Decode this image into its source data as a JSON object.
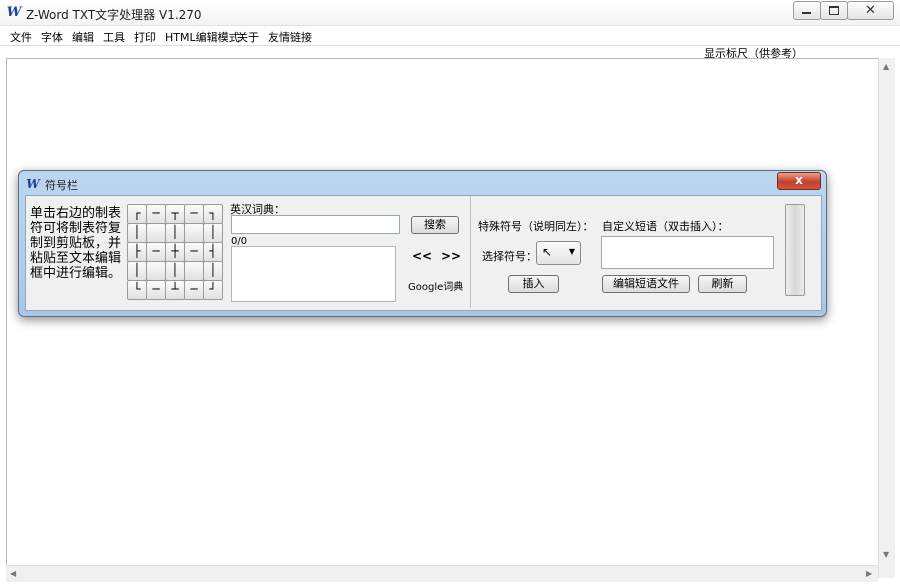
{
  "window": {
    "title": "Z-Word TXT文字处理器 V1.270",
    "app_icon": "W",
    "controls": {
      "minimize_icon": "minimize-icon",
      "maximize_icon": "maximize-icon",
      "close_icon": "close-icon"
    }
  },
  "menu": {
    "items": [
      {
        "label": "文件"
      },
      {
        "label": "字体"
      },
      {
        "label": "编辑"
      },
      {
        "label": "工具"
      },
      {
        "label": "打印"
      },
      {
        "label": "HTML编辑模式"
      },
      {
        "label": "关于"
      },
      {
        "label": "友情链接"
      }
    ]
  },
  "ruler_label": "显示标尺（供参考）",
  "palette": {
    "title": "符号栏",
    "icon": "W",
    "close_label": "x",
    "instructions": "单击右边的制表符可将制表符复制到剪贴板，并粘贴至文本编辑框中进行编辑。",
    "box_chars": [
      [
        "┌",
        "─",
        "┬",
        "─",
        "┐"
      ],
      [
        "│",
        "",
        "│",
        "",
        "│"
      ],
      [
        "├",
        "─",
        "┼",
        "─",
        "┤"
      ],
      [
        "│",
        "",
        "│",
        "",
        "│"
      ],
      [
        "└",
        "─",
        "┴",
        "─",
        "┘"
      ]
    ],
    "dictionary": {
      "label": "英汉词典：",
      "input_value": "",
      "search_label": "搜索",
      "count": "0/0",
      "prev_label": "<<",
      "next_label": ">>",
      "google_label": "Google词典"
    },
    "special": {
      "label": "特殊符号（说明同左）：",
      "select_label": "选择符号：",
      "selected_symbol": "↖",
      "insert_label": "插入"
    },
    "custom": {
      "label": "自定义短语（双击插入）：",
      "edit_label": "编辑短语文件",
      "refresh_label": "刷新"
    }
  }
}
